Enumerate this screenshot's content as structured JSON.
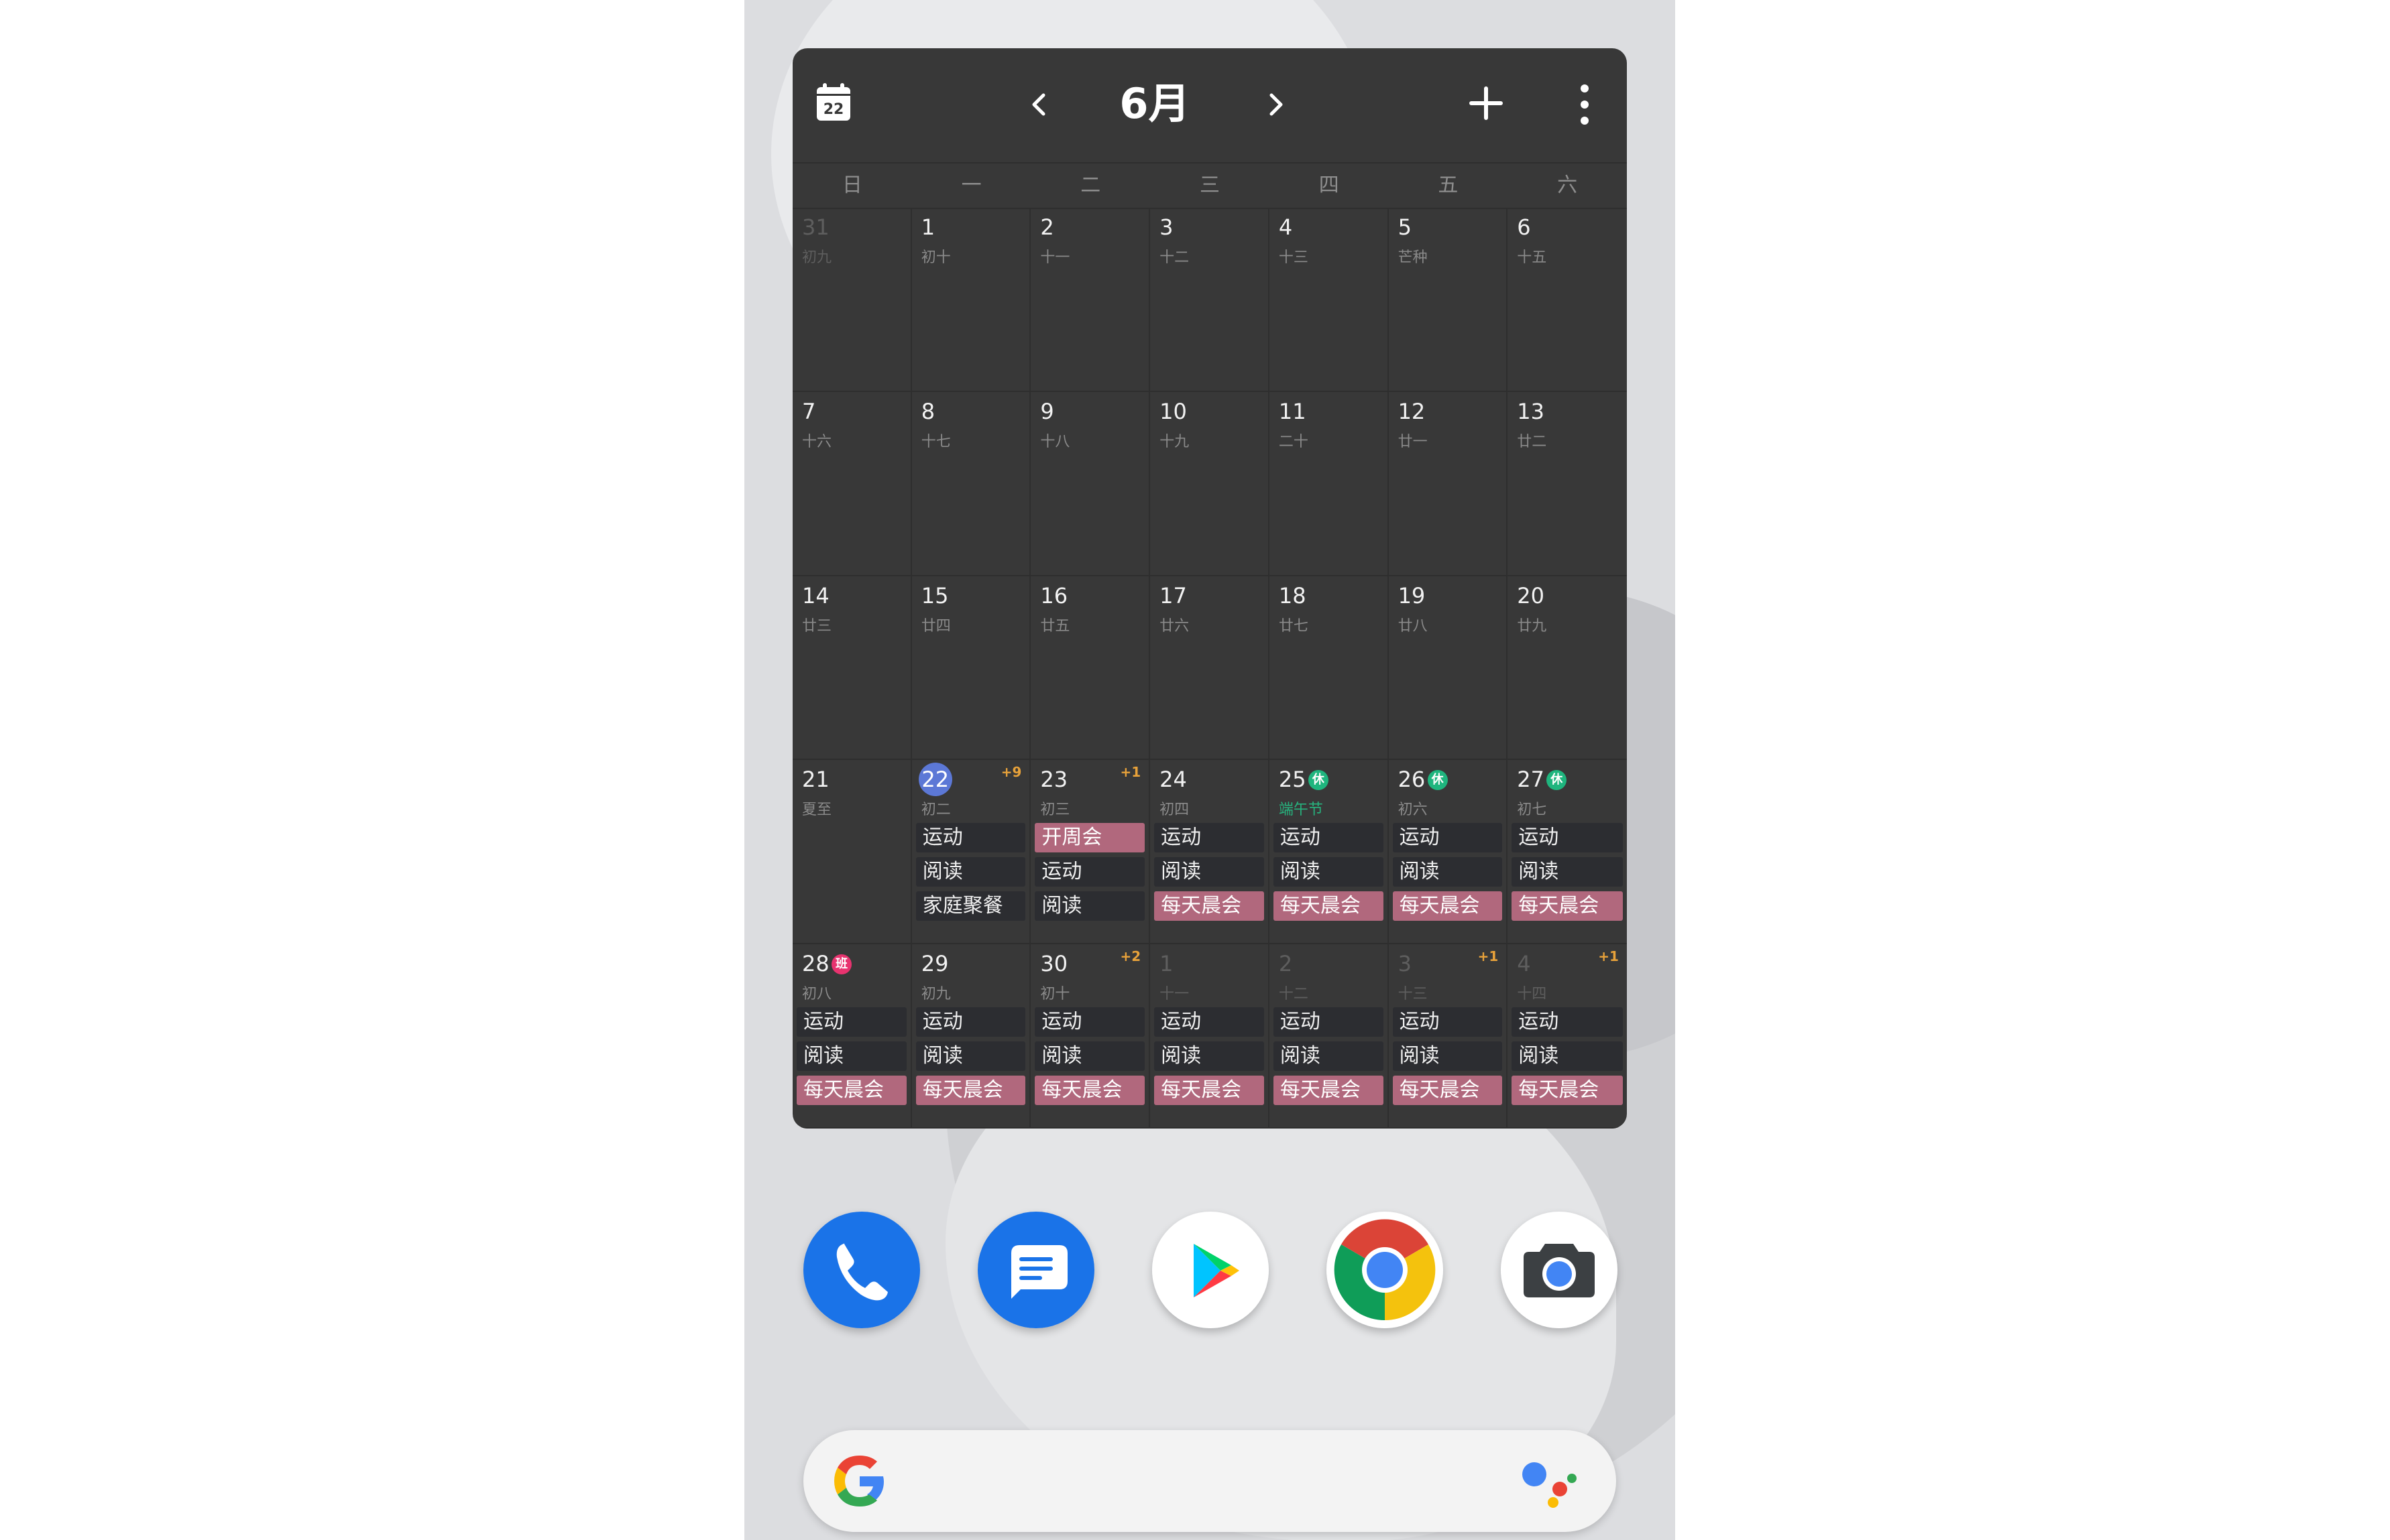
{
  "header": {
    "calendar_icon_date": "22",
    "month_title": "6月"
  },
  "weekdays": [
    "日",
    "一",
    "二",
    "三",
    "四",
    "五",
    "六"
  ],
  "weeks": [
    [
      {
        "day": "31",
        "lunar": "初九",
        "other": true
      },
      {
        "day": "1",
        "lunar": "初十"
      },
      {
        "day": "2",
        "lunar": "十一"
      },
      {
        "day": "3",
        "lunar": "十二"
      },
      {
        "day": "4",
        "lunar": "十三"
      },
      {
        "day": "5",
        "lunar": "芒种"
      },
      {
        "day": "6",
        "lunar": "十五"
      }
    ],
    [
      {
        "day": "7",
        "lunar": "十六"
      },
      {
        "day": "8",
        "lunar": "十七"
      },
      {
        "day": "9",
        "lunar": "十八"
      },
      {
        "day": "10",
        "lunar": "十九"
      },
      {
        "day": "11",
        "lunar": "二十"
      },
      {
        "day": "12",
        "lunar": "廿一"
      },
      {
        "day": "13",
        "lunar": "廿二"
      }
    ],
    [
      {
        "day": "14",
        "lunar": "廿三"
      },
      {
        "day": "15",
        "lunar": "廿四"
      },
      {
        "day": "16",
        "lunar": "廿五"
      },
      {
        "day": "17",
        "lunar": "廿六"
      },
      {
        "day": "18",
        "lunar": "廿七"
      },
      {
        "day": "19",
        "lunar": "廿八"
      },
      {
        "day": "20",
        "lunar": "廿九"
      }
    ],
    [
      {
        "day": "21",
        "lunar": "夏至"
      },
      {
        "day": "22",
        "lunar": "初二",
        "today": true,
        "more": "+9",
        "events": [
          {
            "title": "运动"
          },
          {
            "title": "阅读"
          },
          {
            "title": "家庭聚餐"
          }
        ]
      },
      {
        "day": "23",
        "lunar": "初三",
        "more": "+1",
        "events": [
          {
            "title": "开周会",
            "pink": true
          },
          {
            "title": "运动"
          },
          {
            "title": "阅读"
          }
        ]
      },
      {
        "day": "24",
        "lunar": "初四",
        "events": [
          {
            "title": "运动"
          },
          {
            "title": "阅读"
          },
          {
            "title": "每天晨会",
            "pink": true
          }
        ]
      },
      {
        "day": "25",
        "lunar": "端午节",
        "festival": true,
        "badge": "休",
        "badge_type": "rest",
        "events": [
          {
            "title": "运动"
          },
          {
            "title": "阅读"
          },
          {
            "title": "每天晨会",
            "pink": true
          }
        ]
      },
      {
        "day": "26",
        "lunar": "初六",
        "badge": "休",
        "badge_type": "rest",
        "events": [
          {
            "title": "运动"
          },
          {
            "title": "阅读"
          },
          {
            "title": "每天晨会",
            "pink": true
          }
        ]
      },
      {
        "day": "27",
        "lunar": "初七",
        "badge": "休",
        "badge_type": "rest",
        "events": [
          {
            "title": "运动"
          },
          {
            "title": "阅读"
          },
          {
            "title": "每天晨会",
            "pink": true
          }
        ]
      }
    ],
    [
      {
        "day": "28",
        "lunar": "初八",
        "badge": "班",
        "badge_type": "work",
        "events": [
          {
            "title": "运动"
          },
          {
            "title": "阅读"
          },
          {
            "title": "每天晨会",
            "pink": true
          }
        ]
      },
      {
        "day": "29",
        "lunar": "初九",
        "events": [
          {
            "title": "运动"
          },
          {
            "title": "阅读"
          },
          {
            "title": "每天晨会",
            "pink": true
          }
        ]
      },
      {
        "day": "30",
        "lunar": "初十",
        "more": "+2",
        "events": [
          {
            "title": "运动"
          },
          {
            "title": "阅读"
          },
          {
            "title": "每天晨会",
            "pink": true
          }
        ]
      },
      {
        "day": "1",
        "lunar": "十一",
        "other": true,
        "events": [
          {
            "title": "运动"
          },
          {
            "title": "阅读"
          },
          {
            "title": "每天晨会",
            "pink": true
          }
        ]
      },
      {
        "day": "2",
        "lunar": "十二",
        "other": true,
        "events": [
          {
            "title": "运动"
          },
          {
            "title": "阅读"
          },
          {
            "title": "每天晨会",
            "pink": true
          }
        ]
      },
      {
        "day": "3",
        "lunar": "十三",
        "other": true,
        "more": "+1",
        "events": [
          {
            "title": "运动"
          },
          {
            "title": "阅读"
          },
          {
            "title": "每天晨会",
            "pink": true
          }
        ]
      },
      {
        "day": "4",
        "lunar": "十四",
        "other": true,
        "more": "+1",
        "events": [
          {
            "title": "运动"
          },
          {
            "title": "阅读"
          },
          {
            "title": "每天晨会",
            "pink": true
          }
        ]
      }
    ]
  ],
  "dock": [
    {
      "name": "phone-app",
      "icon": "phone-icon"
    },
    {
      "name": "messages-app",
      "icon": "message-icon"
    },
    {
      "name": "play-store-app",
      "icon": "play-store-icon"
    },
    {
      "name": "chrome-app",
      "icon": "chrome-icon"
    },
    {
      "name": "camera-app",
      "icon": "camera-icon"
    }
  ],
  "colors": {
    "widget_bg": "#383838",
    "today_circle": "#5c78d6",
    "event_pink": "#b1687d",
    "rest_badge": "#1fb57e",
    "work_badge": "#e8336f",
    "more_count": "#e8a23a"
  }
}
